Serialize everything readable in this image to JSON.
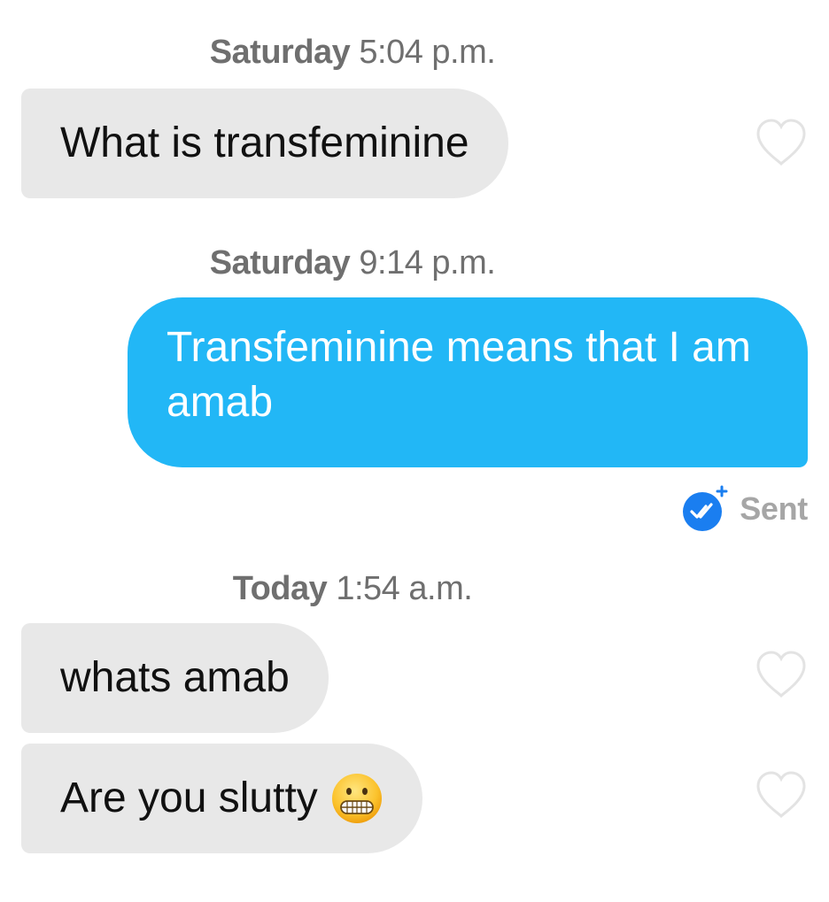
{
  "conversation": {
    "messages": [
      {
        "timestamp_day": "Saturday",
        "timestamp_time": "5:04 p.m.",
        "direction": "incoming",
        "text": "What is transfeminine",
        "liked": false
      },
      {
        "timestamp_day": "Saturday",
        "timestamp_time": "9:14 p.m.",
        "direction": "outgoing",
        "text": "Transfeminine means that I am amab",
        "status": "Sent"
      },
      {
        "timestamp_day": "Today",
        "timestamp_time": "1:54 a.m.",
        "direction": "incoming",
        "text": "whats amab",
        "liked": false
      },
      {
        "direction": "incoming",
        "text": "Are you slutty",
        "emoji": "grimacing-face-emoji",
        "liked": false
      }
    ]
  },
  "icons": {
    "like": "heart-outline-icon",
    "sent_badge": "double-check-icon",
    "emoji": "grimacing-face-emoji"
  },
  "colors": {
    "incoming_bubble": "#e8e8e8",
    "outgoing_bubble": "#22b7f6",
    "timestamp_text": "#6f6f6f",
    "status_text": "#a6a6a6",
    "badge_blue": "#1a7ef0"
  }
}
